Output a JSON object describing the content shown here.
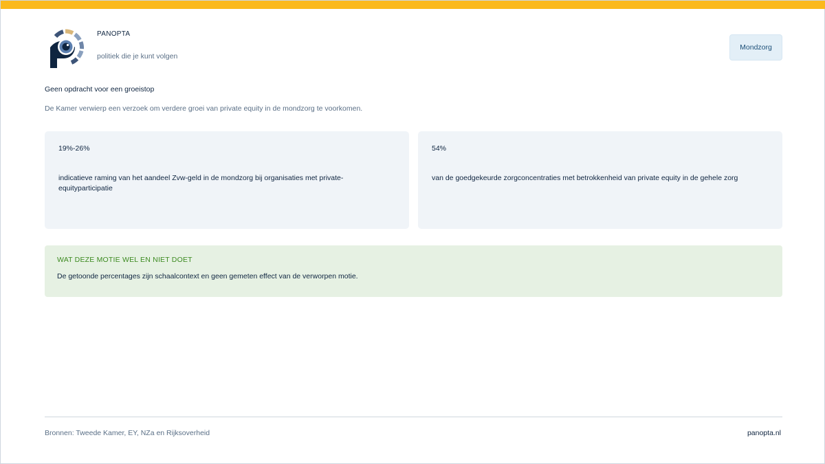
{
  "brand": {
    "name": "PANOPTA",
    "tagline": "politiek die je kunt volgen",
    "logo_icon": "panopta-eye-logo-icon",
    "colors": {
      "accent": "#fbb91c",
      "navy": "#0f2540",
      "logo_gold": "#d9b77a",
      "logo_slate": "#6f86a8"
    }
  },
  "topic_tag": "Mondzorg",
  "headline": {
    "title": "Geen opdracht voor een groeistop",
    "subtitle": "De Kamer verwierp een verzoek om verdere groei van private equity in de mondzorg te voorkomen."
  },
  "stats": [
    {
      "value": "19%-26%",
      "description": "indicatieve raming van het aandeel Zvw-geld in de mondzorg bij organisaties met private-equityparticipatie"
    },
    {
      "value": "54%",
      "description": "van de goedgekeurde zorgconcentraties met betrokkenheid van private equity in de gehele zorg"
    }
  ],
  "note": {
    "heading": "WAT DEZE MOTIE WEL EN NIET DOET",
    "text": "De getoonde percentages zijn schaalcontext en geen gemeten effect van de verworpen motie.",
    "colors": {
      "background": "#e6f1e3",
      "heading": "#3c8a20"
    }
  },
  "footer": {
    "sources": "Bronnen: Tweede Kamer, EY, NZa en Rijksoverheid",
    "site": "panopta.nl"
  }
}
